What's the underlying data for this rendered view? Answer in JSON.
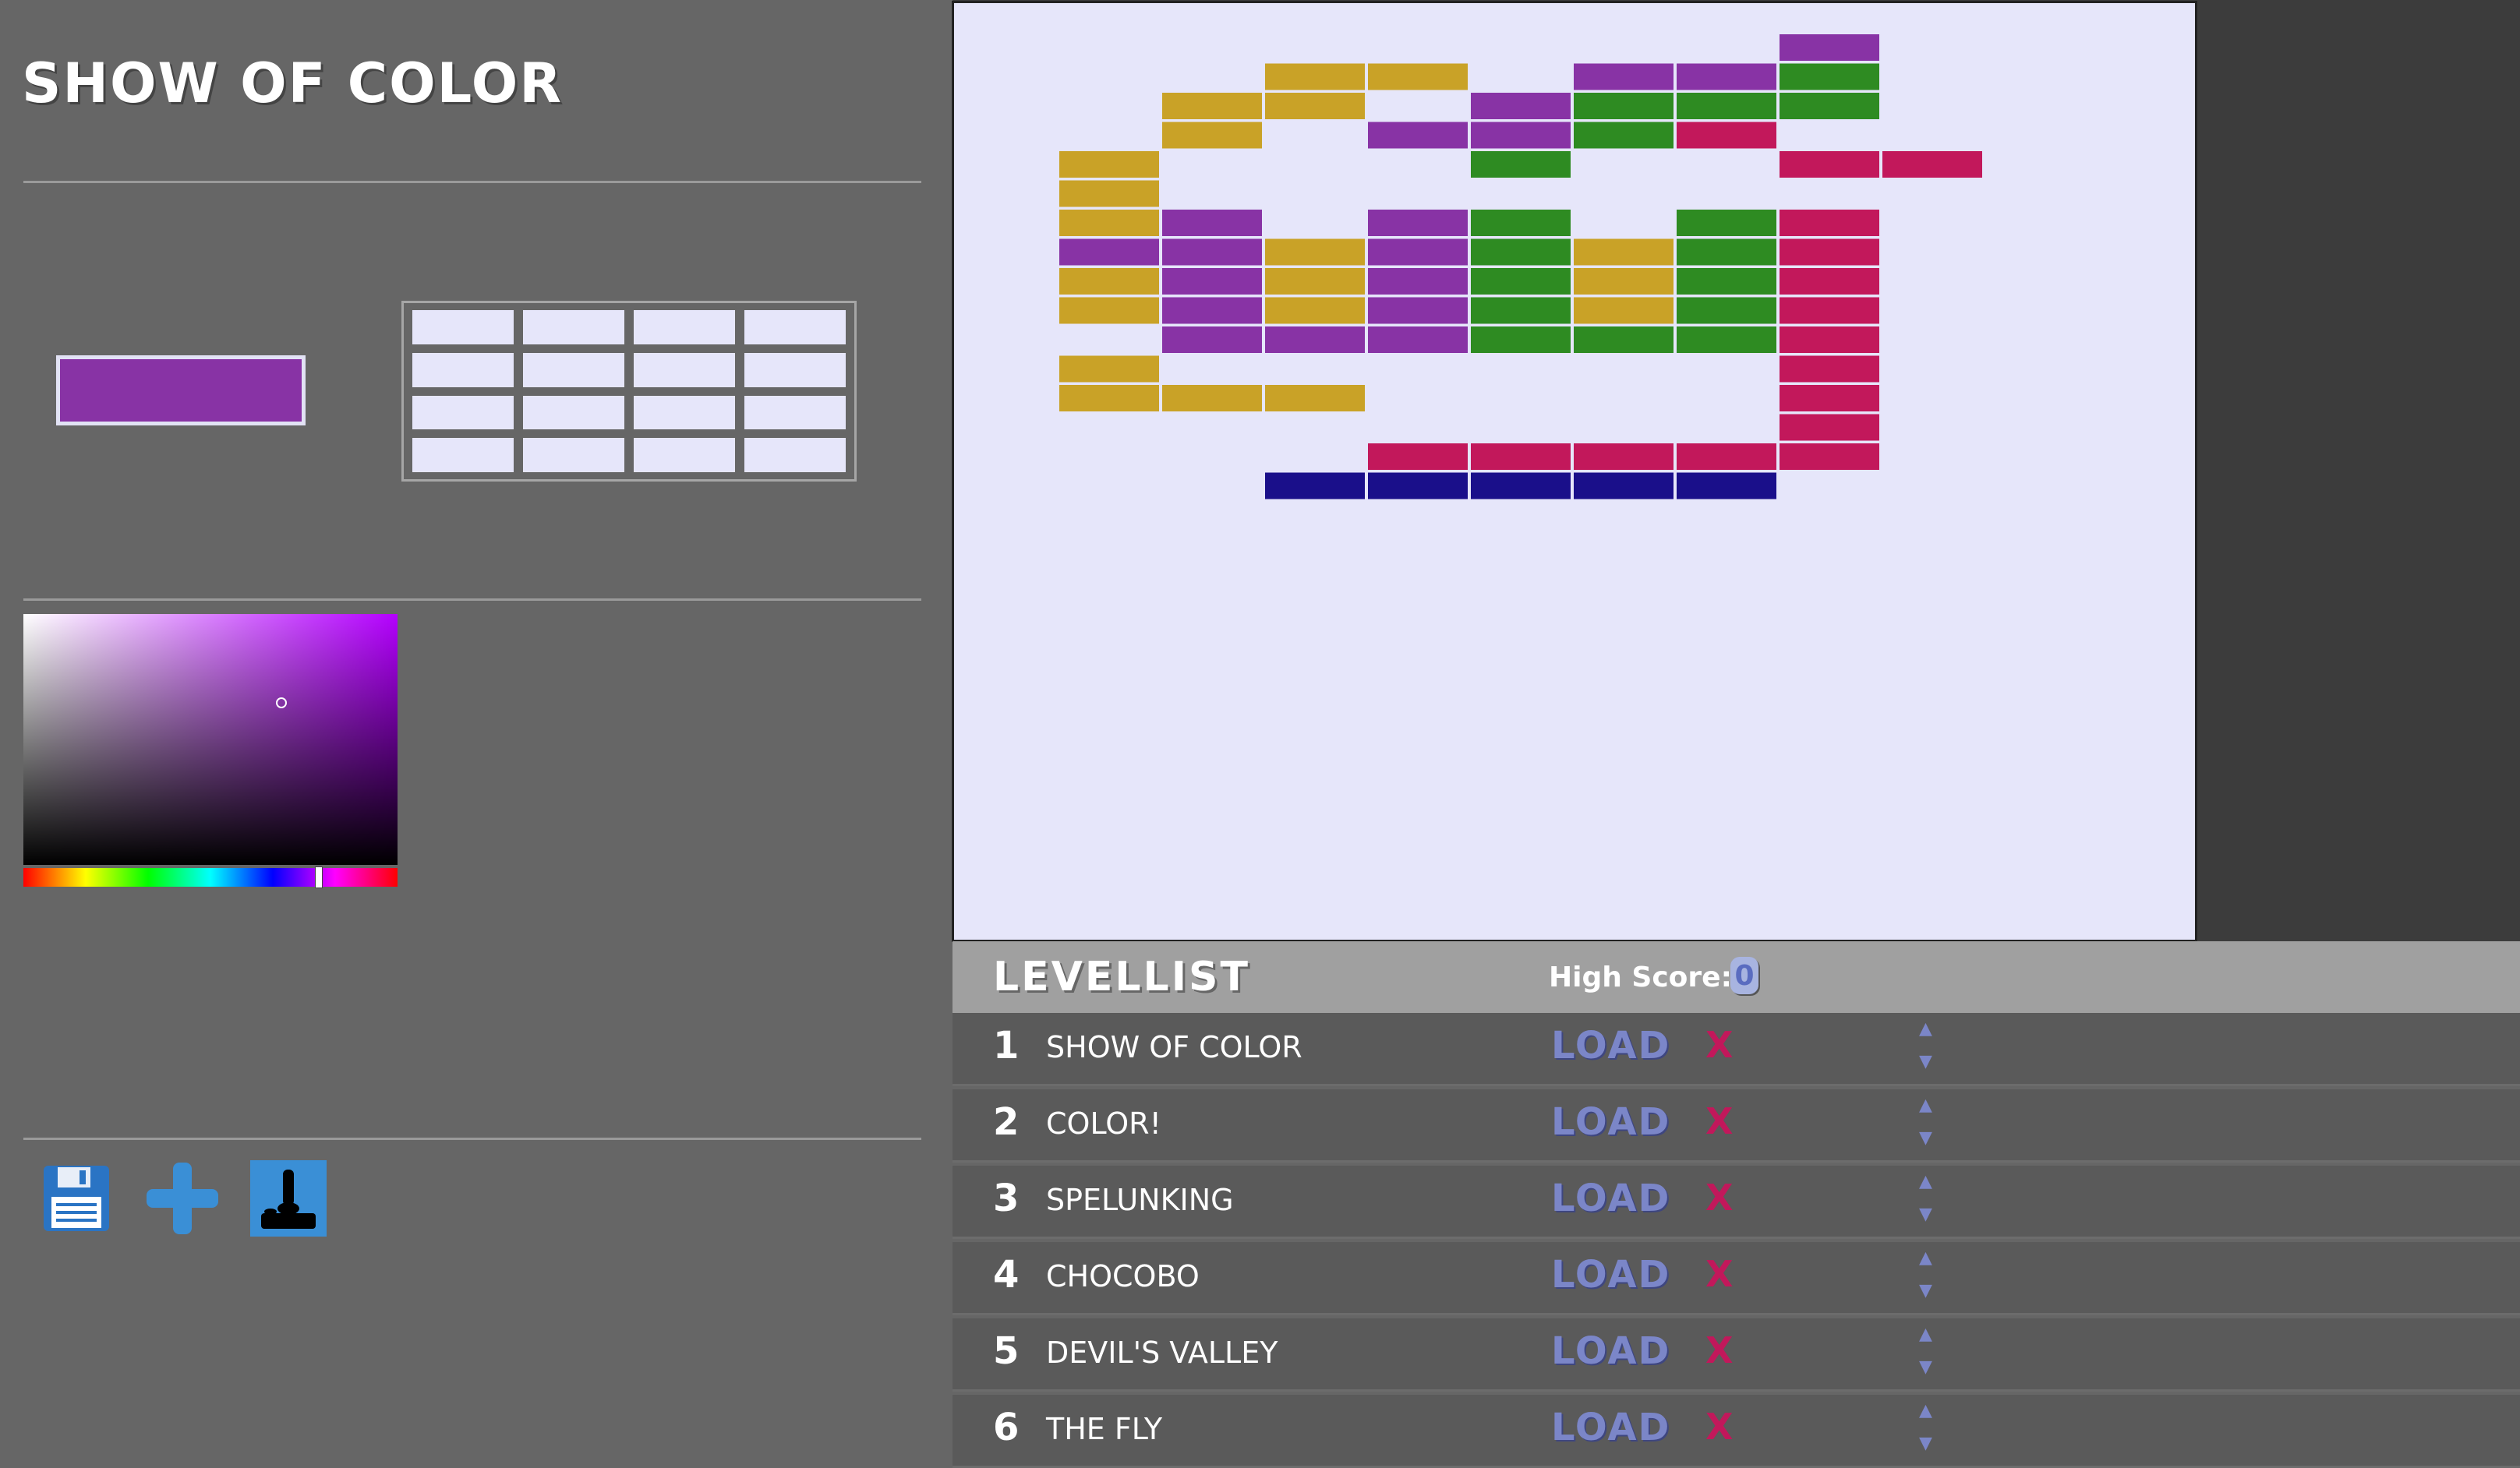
{
  "editor": {
    "level_title": "SHOW OF COLOR",
    "selected_color": "#8833a5",
    "picker_hue_color": "#b400ff",
    "tools": [
      {
        "name": "save",
        "icon": "floppy-disk-icon"
      },
      {
        "name": "add",
        "icon": "plus-icon"
      },
      {
        "name": "play",
        "icon": "joystick-icon"
      }
    ]
  },
  "colors": {
    "gold": "#c9a227",
    "purple": "#8833a5",
    "green": "#2e8b22",
    "pink": "#c2185b",
    "navy": "#1a0f8a",
    "canvas_bg": "#e6e6fa"
  },
  "levellist": {
    "title": "LEVELLIST",
    "high_score_label": "High Score:",
    "high_score_value": "0",
    "load_label": "LOAD",
    "delete_label": "X",
    "up_label": "▲",
    "down_label": "▼",
    "levels": [
      {
        "num": "1",
        "name": "SHOW OF COLOR"
      },
      {
        "num": "2",
        "name": "COLOR!"
      },
      {
        "num": "3",
        "name": "SPELUNKING"
      },
      {
        "num": "4",
        "name": "CHOCOBO"
      },
      {
        "num": "5",
        "name": "DEVIL'S VALLEY"
      },
      {
        "num": "6",
        "name": "THE FLY"
      }
    ]
  }
}
